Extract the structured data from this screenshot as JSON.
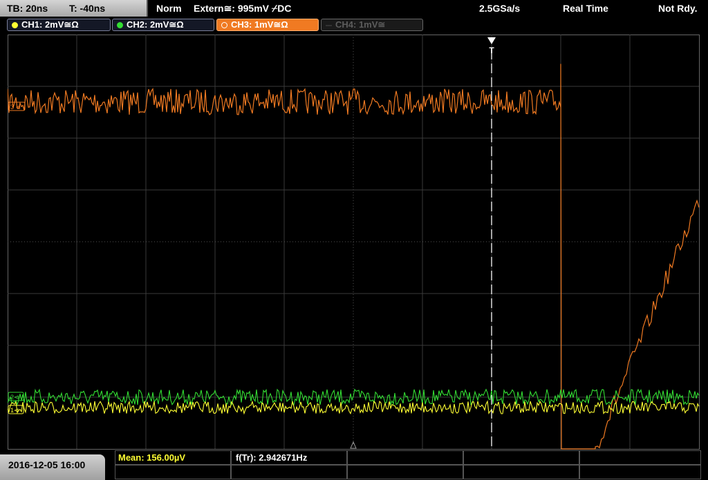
{
  "status": {
    "timebase": "TB: 20ns",
    "trigger_offset": "T: -40ns",
    "mode": "Norm",
    "trigger_source": "Extern≅: 995mV ⌿DC",
    "sample_rate": "2.5GSa/s",
    "acq_mode": "Real Time",
    "ready_state": "Not Rdy."
  },
  "channels": [
    {
      "label": "CH1: 2mV≅Ω",
      "color": "#ffff33",
      "state": "on"
    },
    {
      "label": "CH2: 2mV≅Ω",
      "color": "#33dd33",
      "state": "on"
    },
    {
      "label": "CH3: 1mV≅Ω",
      "color": "#f07a22",
      "state": "selected"
    },
    {
      "label": "CH4: 1mV≅",
      "color": "#555555",
      "state": "off"
    }
  ],
  "markers": {
    "trigger": "T",
    "ch3_level": "3 ⊲",
    "ch2_level": "2⊲",
    "ch1_level": "1⊲"
  },
  "colors": {
    "grid": "#3a3a3a",
    "grid_center": "#555555",
    "ch1": "#ffff33",
    "ch2": "#33dd33",
    "ch3": "#f07a22",
    "trigger_line": "#ffffff"
  },
  "measurements": {
    "mean": "Mean: 156.00µV",
    "frequency": "f(Tr): 2.942671Hz"
  },
  "timestamp": "2016-12-05 16:00",
  "chart_data": {
    "type": "line",
    "x_divisions": 10,
    "y_divisions": 8,
    "series": [
      {
        "name": "CH3",
        "baseline_div": 1.3,
        "noise_div": 0.25,
        "edge_div": 8.0,
        "after_div": 7.6
      },
      {
        "name": "CH2",
        "baseline_div": 7.0,
        "noise_div": 0.15
      },
      {
        "name": "CH1",
        "baseline_div": 7.2,
        "noise_div": 0.12
      }
    ]
  }
}
